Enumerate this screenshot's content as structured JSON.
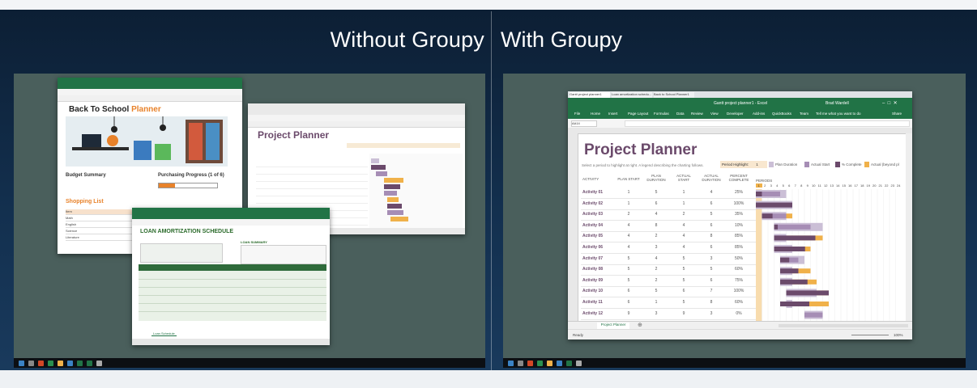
{
  "titles": {
    "left": "Without Groupy",
    "right": "With Groupy"
  },
  "left": {
    "school": {
      "title_a": "Back To School ",
      "title_b": "Planner",
      "budget": "Budget Summary",
      "progress": "Purchasing Progress (1 of 6)",
      "shopping": "Shopping List",
      "items": [
        "Item",
        "Math",
        "English",
        "Science",
        "Literature"
      ]
    },
    "loan": {
      "title": "LOAN AMORTIZATION SCHEDULE",
      "summary": "LOAN SUMMARY",
      "tab": "Loan Schedule"
    },
    "planner": {
      "title": "Project Planner"
    }
  },
  "right": {
    "tabs": [
      "Gantt project planner1",
      "Loan amortization schedu...",
      "Back to School Planner1"
    ],
    "window_title": "Gantt project planner1 - Excel",
    "user": "Brad Wardell",
    "ribbon": [
      "File",
      "Home",
      "Insert",
      "Page Layout",
      "Formulas",
      "Data",
      "Review",
      "View",
      "Developer",
      "Add-ins",
      "QuickBooks",
      "Team",
      "Tell me what you want to do"
    ],
    "share": "Share",
    "namebox": "AA14",
    "planner_title": "Project Planner",
    "subtitle": "Select a period to highlight at right.  A legend describing the charting follows.",
    "period_label": "Period Highlight:",
    "period_value": "1",
    "legend": [
      "Plan Duration",
      "Actual Start",
      "% Complete",
      "Actual (beyond pl"
    ],
    "col_headers": [
      "ACTIVITY",
      "PLAN START",
      "PLAN DURATION",
      "ACTUAL START",
      "ACTUAL DURATION",
      "PERCENT COMPLETE"
    ],
    "periods_label": "PERIODS",
    "periods": [
      "1",
      "2",
      "3",
      "4",
      "5",
      "6",
      "7",
      "8",
      "9",
      "10",
      "11",
      "12",
      "13",
      "14",
      "15",
      "16",
      "17",
      "18",
      "19",
      "20",
      "21",
      "22",
      "23",
      "24"
    ],
    "activities": [
      {
        "name": "Activity 01",
        "ps": "1",
        "pd": "5",
        "as": "1",
        "ad": "4",
        "pc": "25%"
      },
      {
        "name": "Activity 02",
        "ps": "1",
        "pd": "6",
        "as": "1",
        "ad": "6",
        "pc": "100%"
      },
      {
        "name": "Activity 03",
        "ps": "2",
        "pd": "4",
        "as": "2",
        "ad": "5",
        "pc": "35%"
      },
      {
        "name": "Activity 04",
        "ps": "4",
        "pd": "8",
        "as": "4",
        "ad": "6",
        "pc": "10%"
      },
      {
        "name": "Activity 05",
        "ps": "4",
        "pd": "2",
        "as": "4",
        "ad": "8",
        "pc": "85%"
      },
      {
        "name": "Activity 06",
        "ps": "4",
        "pd": "3",
        "as": "4",
        "ad": "6",
        "pc": "85%"
      },
      {
        "name": "Activity 07",
        "ps": "5",
        "pd": "4",
        "as": "5",
        "ad": "3",
        "pc": "50%"
      },
      {
        "name": "Activity 08",
        "ps": "5",
        "pd": "2",
        "as": "5",
        "ad": "5",
        "pc": "60%"
      },
      {
        "name": "Activity 09",
        "ps": "5",
        "pd": "2",
        "as": "5",
        "ad": "6",
        "pc": "75%"
      },
      {
        "name": "Activity 10",
        "ps": "6",
        "pd": "5",
        "as": "6",
        "ad": "7",
        "pc": "100%"
      },
      {
        "name": "Activity 11",
        "ps": "6",
        "pd": "1",
        "as": "5",
        "ad": "8",
        "pc": "60%"
      },
      {
        "name": "Activity 12",
        "ps": "9",
        "pd": "3",
        "as": "9",
        "ad": "3",
        "pc": "0%"
      }
    ],
    "sheet_tab": "Project Planner",
    "status": "Ready",
    "zoom": "100%"
  },
  "colors": {
    "excel_green": "#217346",
    "plan": "#cbbfd6",
    "actual": "#a68db5",
    "complete": "#6b4a6b",
    "beyond": "#f0b14a"
  }
}
